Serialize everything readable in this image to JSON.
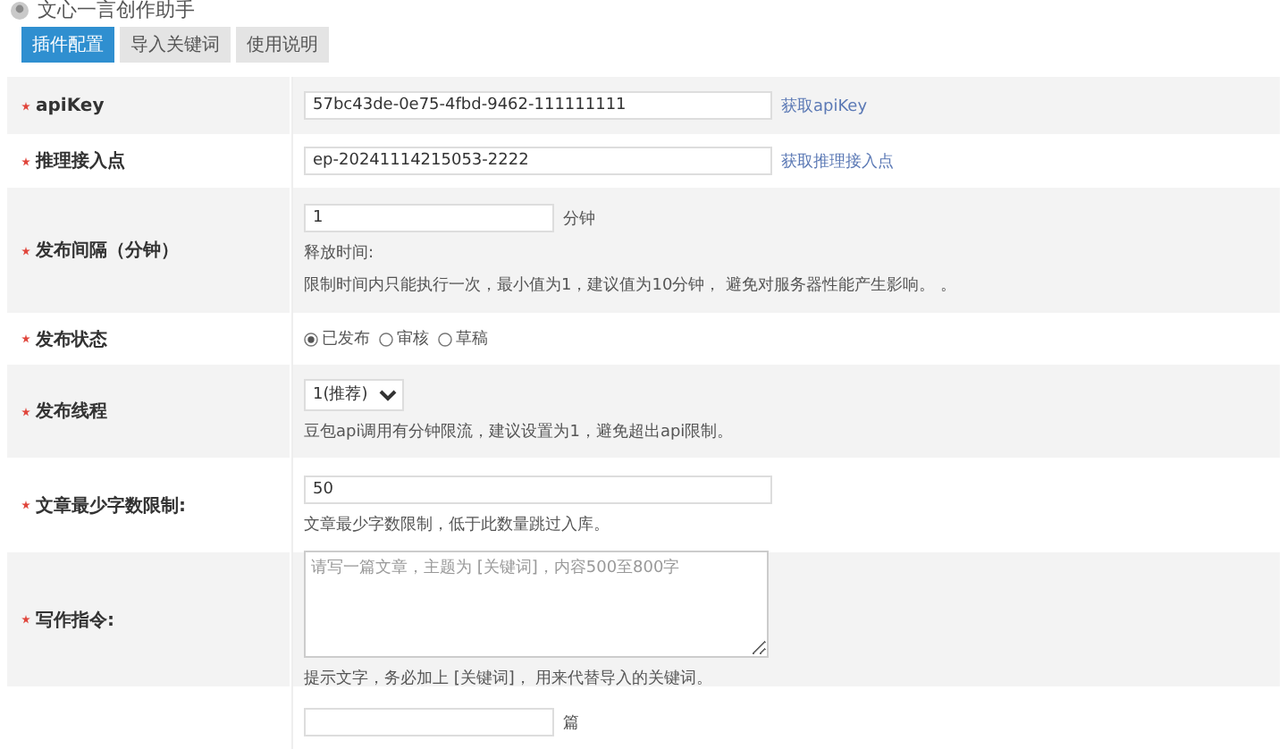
{
  "app": {
    "title": "文心一言创作助手"
  },
  "tabs": [
    {
      "label": "插件配置",
      "selected": true
    },
    {
      "label": "导入关键词",
      "selected": false
    },
    {
      "label": "使用说明",
      "selected": false
    }
  ],
  "fields": [
    {
      "kind": "text",
      "label": "apiKey",
      "required": true,
      "value": "57bc43de-0e75-4fbd-9462-111111111",
      "link": "获取apiKey"
    },
    {
      "kind": "text",
      "label": "推理接入点",
      "required": true,
      "value": "ep-20241114215053-2222",
      "link": "获取推理接入点"
    },
    {
      "kind": "short",
      "label": "发布间隔（分钟）",
      "required": true,
      "value": "1",
      "unit": "分钟",
      "notes": [
        "释放时间:",
        "限制时间内只能执行一次，最小值为1，建议值为10分钟， 避免对服务器性能产生影响。 。"
      ]
    },
    {
      "kind": "radio",
      "label": "发布状态",
      "required": true,
      "options": [
        {
          "label": "已发布",
          "selected": true
        },
        {
          "label": "审核",
          "selected": false
        },
        {
          "label": "草稿",
          "selected": false
        }
      ]
    },
    {
      "kind": "select",
      "label": "发布线程",
      "required": true,
      "value": "1(推荐)",
      "notes": [
        "豆包api调用有分钟限流，建议设置为1，避免超出api限制。"
      ]
    },
    {
      "kind": "text",
      "label": "文章最少字数限制:",
      "required": true,
      "value": "50",
      "notes": [
        "文章最少字数限制，低于此数量跳过入库。"
      ]
    },
    {
      "kind": "textarea",
      "label": "写作指令:",
      "required": true,
      "placeholder": "请写一篇文章，主题为 [关键词]，内容500至800字",
      "notes": [
        "提示文字，务必加上 [关键词]， 用来代替导入的关键词。"
      ]
    },
    {
      "kind": "short",
      "required": false,
      "unit": "篇"
    }
  ]
}
